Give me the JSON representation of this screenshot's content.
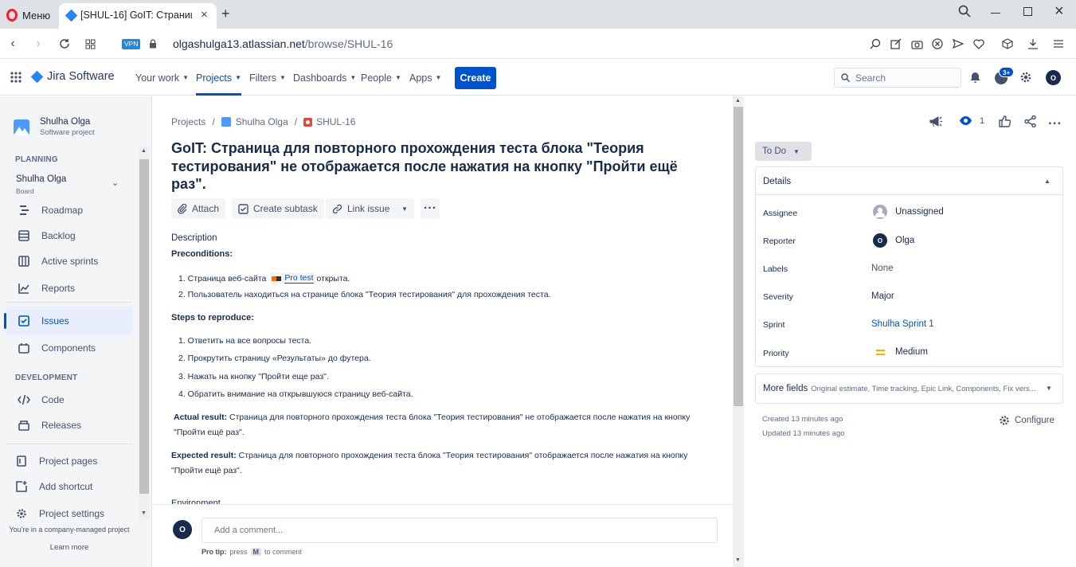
{
  "browser": {
    "menu_label": "Меню",
    "tab_title": "[SHUL-16] GoIT: Страница",
    "vpn_label": "VPN",
    "url_host": "olgashulga13.atlassian.net",
    "url_path": "/browse/SHUL-16"
  },
  "nav": {
    "logo": "Jira Software",
    "items": [
      "Your work",
      "Projects",
      "Filters",
      "Dashboards",
      "People",
      "Apps"
    ],
    "create_label": "Create",
    "search_placeholder": "Search",
    "notif_badge": "3+",
    "profile_initial": "O"
  },
  "sidebar": {
    "project_name": "Shulha Olga",
    "project_type": "Software project",
    "planning_heading": "PLANNING",
    "board_name": "Shulha Olga",
    "board_sub": "Board",
    "planning_items": [
      "Roadmap",
      "Backlog",
      "Active sprints",
      "Reports"
    ],
    "issues_label": "Issues",
    "components_label": "Components",
    "development_heading": "DEVELOPMENT",
    "dev_items": [
      "Code",
      "Releases"
    ],
    "bottom_items": [
      "Project pages",
      "Add shortcut",
      "Project settings"
    ],
    "footer_text": "You're in a company-managed project",
    "learn_more": "Learn more"
  },
  "issue": {
    "breadcrumb": [
      "Projects",
      "Shulha Olga",
      "SHUL-16"
    ],
    "title": "GoIT: Страница для повторного прохождения теста блока \"Теория тестирования\" не отображается после нажатия на кнопку \"Пройти ещё раз\".",
    "actions": {
      "attach": "Attach",
      "subtask": "Create subtask",
      "link": "Link issue"
    },
    "description_label": "Description",
    "preconditions_label": "Preconditions:",
    "pre_1a": "1. Страница веб-сайта",
    "pre_1_link": "Pro test",
    "pre_1b": "открыта.",
    "pre_2": "2. Пользователь находиться на странице блока \"Теория тестирования\" для прохождения теста.",
    "steps_label": "Steps to reproduce:",
    "steps": [
      "1. Ответить на все вопросы теста.",
      "2. Прокрутить страницу «Результаты» до футера.",
      "3. Нажать на кнопку \"Пройти еще раз\".",
      "4. Обратить внимание на открывшуюся страницу веб-сайта."
    ],
    "actual_label": "Actual result:",
    "actual_text": "Страница для повторного прохождения теста блока \"Теория тестирования\" не отображается после нажатия на кнопку \"Пройти ещё раз\".",
    "expected_label": "Expected result:",
    "expected_text": "Страница для повторного прохождения теста блока \"Теория тестирования\" отображается после нажатия на кнопку \"Пройти ещё раз\".",
    "environment_label": "Environment",
    "comment_placeholder": "Add a comment...",
    "commenter_initial": "O",
    "protip_label": "Pro tip:",
    "protip_press": "press",
    "protip_key": "M",
    "protip_tail": "to comment"
  },
  "panel": {
    "watch_count": "1",
    "status": "To Do",
    "details_heading": "Details",
    "fields": [
      {
        "label": "Assignee",
        "value": "Unassigned"
      },
      {
        "label": "Reporter",
        "value": "Olga"
      },
      {
        "label": "Labels",
        "value": "None"
      },
      {
        "label": "Severity",
        "value": "Major"
      },
      {
        "label": "Sprint",
        "value": "Shulha Sprint 1"
      },
      {
        "label": "Priority",
        "value": "Medium"
      }
    ],
    "more_fields_label": "More fields",
    "more_fields_desc": "Original estimate, Time tracking, Epic Link, Components, Fix vers...",
    "created": "Created 13 minutes ago",
    "updated": "Updated 13 minutes ago",
    "configure_label": "Configure",
    "colors": {
      "link": "#0052cc",
      "priority": "#ffab00",
      "create": "#0052cc",
      "bug": "#e5493a"
    }
  }
}
